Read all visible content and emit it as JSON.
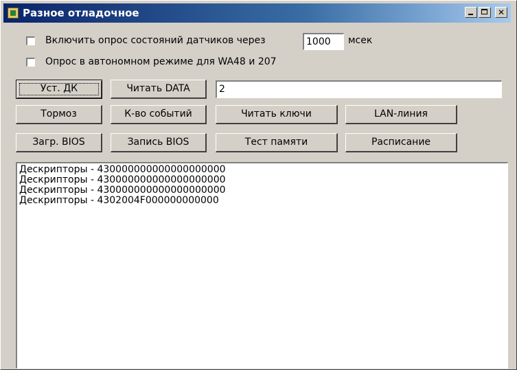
{
  "window": {
    "title": "Разное отладочное"
  },
  "options": {
    "poll_label": "Включить опрос состояний датчиков через",
    "poll_interval": "1000",
    "poll_unit": "мсек",
    "autonomous_label": "Опрос в автономном режиме для WA48 и 207"
  },
  "controls": {
    "set_dk": "Уст. ДК",
    "read_data": "Читать DATA",
    "data_value": "2",
    "brake": "Тормоз",
    "event_count": "К-во событий",
    "read_keys": "Читать ключи",
    "lan_line": "LAN-линия",
    "load_bios": "Загр. BIOS",
    "write_bios": "Запись BIOS",
    "memory_test": "Тест памяти",
    "schedule": "Расписание"
  },
  "log": {
    "lines": [
      "Дескрипторы - 430000000000000000000",
      "Дескрипторы - 430000000000000000000",
      "Дескрипторы - 430000000000000000000",
      "Дескрипторы - 4302004F000000000000"
    ]
  }
}
